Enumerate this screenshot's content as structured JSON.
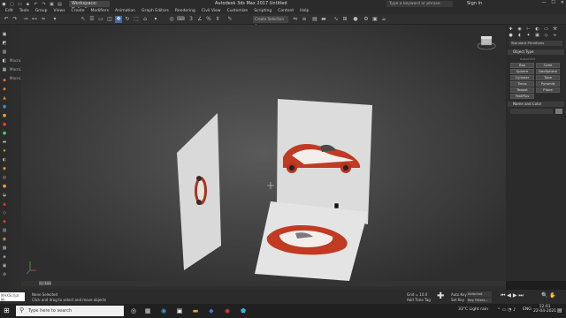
{
  "titlebar": {
    "workspace": "Workspace: Default",
    "app_title": "Autodesk 3ds Max 2017    Untitled",
    "search_placeholder": "Type a keyword or phrase",
    "signin": "Sign In",
    "icons": [
      "logo-icon",
      "undo-icon",
      "redo-icon",
      "open-icon",
      "save-icon",
      "minimize-icon",
      "maximize-icon",
      "close-icon"
    ]
  },
  "menubar": {
    "items": [
      "Edit",
      "Tools",
      "Group",
      "Views",
      "Create",
      "Modifiers",
      "Animation",
      "Graph Editors",
      "Rendering",
      "Civil View",
      "Customize",
      "Scripting",
      "Content",
      "Help"
    ]
  },
  "toolbar": {
    "selection_set": "Create Selection Se"
  },
  "left_panel": {
    "labels": [
      "Macro1",
      "Macro2",
      "Macro3"
    ]
  },
  "viewport": {
    "label": "[+] [Perspective] [Standard] [Default Shading]"
  },
  "command_panel": {
    "dropdown": "Standard Primitives",
    "object_type_header": "Object Type",
    "autogrid": "AutoGrid",
    "buttons": [
      "Box",
      "Cone",
      "Sphere",
      "GeoSphere",
      "Cylinder",
      "Tube",
      "Torus",
      "Pyramid",
      "Teapot",
      "Plane",
      "TextPlus"
    ],
    "name_color_header": "Name and Color"
  },
  "timeline": {
    "frame": "0 / 100"
  },
  "statusbar": {
    "maxscript": "MAXScript Mi",
    "selection": "None Selected",
    "prompt": "Click and drag to select and move objects",
    "grid": "Grid = 10.0",
    "add_tag": "Add Time Tag",
    "auto_key": "Auto Key",
    "set_key": "Set Key",
    "selected": "Selected",
    "key_filters": "Key Filters..."
  },
  "taskbar": {
    "search_placeholder": "Type here to search",
    "weather": "33°C  Light rain",
    "lang": "ENG",
    "time": "12:01",
    "date": "22-04-2021"
  }
}
